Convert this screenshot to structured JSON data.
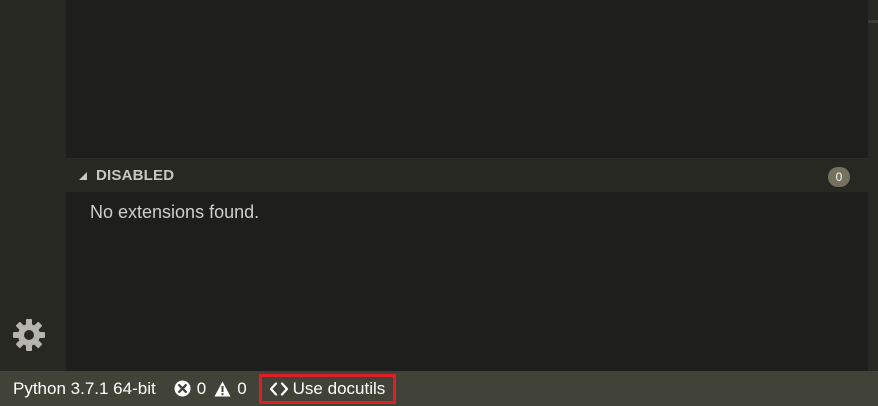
{
  "activity_bar": {
    "settings_icon": "gear-icon"
  },
  "extensions": {
    "sections": [
      {
        "title": "DISABLED",
        "count": "0",
        "empty_message": "No extensions found.",
        "twistie_icon": "triangle-down-icon"
      }
    ]
  },
  "status_bar": {
    "interpreter": "Python 3.7.1 64-bit",
    "errors_count": "0",
    "warnings_count": "0",
    "error_icon": "error-circle-icon",
    "warning_icon": "warning-triangle-icon",
    "docutils_icon": "code-brackets-icon",
    "docutils_label": "Use docutils"
  },
  "colors": {
    "activity_bar_bg": "#272822",
    "editor_bg": "#1e1f1c",
    "status_bar_bg": "#414339",
    "badge_bg": "#75715e",
    "highlight_border": "#e01e25"
  }
}
